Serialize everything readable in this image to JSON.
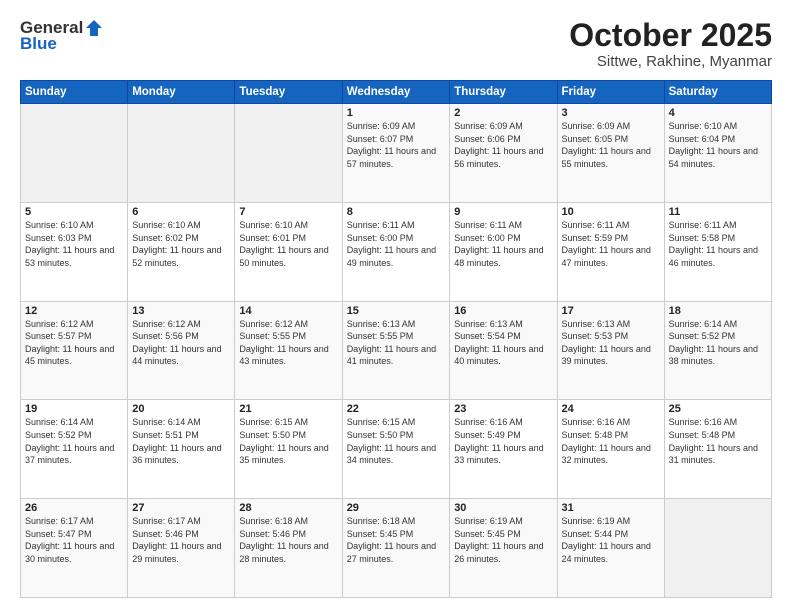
{
  "logo": {
    "general": "General",
    "blue": "Blue"
  },
  "header": {
    "month": "October 2025",
    "location": "Sittwe, Rakhine, Myanmar"
  },
  "weekdays": [
    "Sunday",
    "Monday",
    "Tuesday",
    "Wednesday",
    "Thursday",
    "Friday",
    "Saturday"
  ],
  "weeks": [
    [
      {
        "day": "",
        "sunrise": "",
        "sunset": "",
        "daylight": ""
      },
      {
        "day": "",
        "sunrise": "",
        "sunset": "",
        "daylight": ""
      },
      {
        "day": "",
        "sunrise": "",
        "sunset": "",
        "daylight": ""
      },
      {
        "day": "1",
        "sunrise": "Sunrise: 6:09 AM",
        "sunset": "Sunset: 6:07 PM",
        "daylight": "Daylight: 11 hours and 57 minutes."
      },
      {
        "day": "2",
        "sunrise": "Sunrise: 6:09 AM",
        "sunset": "Sunset: 6:06 PM",
        "daylight": "Daylight: 11 hours and 56 minutes."
      },
      {
        "day": "3",
        "sunrise": "Sunrise: 6:09 AM",
        "sunset": "Sunset: 6:05 PM",
        "daylight": "Daylight: 11 hours and 55 minutes."
      },
      {
        "day": "4",
        "sunrise": "Sunrise: 6:10 AM",
        "sunset": "Sunset: 6:04 PM",
        "daylight": "Daylight: 11 hours and 54 minutes."
      }
    ],
    [
      {
        "day": "5",
        "sunrise": "Sunrise: 6:10 AM",
        "sunset": "Sunset: 6:03 PM",
        "daylight": "Daylight: 11 hours and 53 minutes."
      },
      {
        "day": "6",
        "sunrise": "Sunrise: 6:10 AM",
        "sunset": "Sunset: 6:02 PM",
        "daylight": "Daylight: 11 hours and 52 minutes."
      },
      {
        "day": "7",
        "sunrise": "Sunrise: 6:10 AM",
        "sunset": "Sunset: 6:01 PM",
        "daylight": "Daylight: 11 hours and 50 minutes."
      },
      {
        "day": "8",
        "sunrise": "Sunrise: 6:11 AM",
        "sunset": "Sunset: 6:00 PM",
        "daylight": "Daylight: 11 hours and 49 minutes."
      },
      {
        "day": "9",
        "sunrise": "Sunrise: 6:11 AM",
        "sunset": "Sunset: 6:00 PM",
        "daylight": "Daylight: 11 hours and 48 minutes."
      },
      {
        "day": "10",
        "sunrise": "Sunrise: 6:11 AM",
        "sunset": "Sunset: 5:59 PM",
        "daylight": "Daylight: 11 hours and 47 minutes."
      },
      {
        "day": "11",
        "sunrise": "Sunrise: 6:11 AM",
        "sunset": "Sunset: 5:58 PM",
        "daylight": "Daylight: 11 hours and 46 minutes."
      }
    ],
    [
      {
        "day": "12",
        "sunrise": "Sunrise: 6:12 AM",
        "sunset": "Sunset: 5:57 PM",
        "daylight": "Daylight: 11 hours and 45 minutes."
      },
      {
        "day": "13",
        "sunrise": "Sunrise: 6:12 AM",
        "sunset": "Sunset: 5:56 PM",
        "daylight": "Daylight: 11 hours and 44 minutes."
      },
      {
        "day": "14",
        "sunrise": "Sunrise: 6:12 AM",
        "sunset": "Sunset: 5:55 PM",
        "daylight": "Daylight: 11 hours and 43 minutes."
      },
      {
        "day": "15",
        "sunrise": "Sunrise: 6:13 AM",
        "sunset": "Sunset: 5:55 PM",
        "daylight": "Daylight: 11 hours and 41 minutes."
      },
      {
        "day": "16",
        "sunrise": "Sunrise: 6:13 AM",
        "sunset": "Sunset: 5:54 PM",
        "daylight": "Daylight: 11 hours and 40 minutes."
      },
      {
        "day": "17",
        "sunrise": "Sunrise: 6:13 AM",
        "sunset": "Sunset: 5:53 PM",
        "daylight": "Daylight: 11 hours and 39 minutes."
      },
      {
        "day": "18",
        "sunrise": "Sunrise: 6:14 AM",
        "sunset": "Sunset: 5:52 PM",
        "daylight": "Daylight: 11 hours and 38 minutes."
      }
    ],
    [
      {
        "day": "19",
        "sunrise": "Sunrise: 6:14 AM",
        "sunset": "Sunset: 5:52 PM",
        "daylight": "Daylight: 11 hours and 37 minutes."
      },
      {
        "day": "20",
        "sunrise": "Sunrise: 6:14 AM",
        "sunset": "Sunset: 5:51 PM",
        "daylight": "Daylight: 11 hours and 36 minutes."
      },
      {
        "day": "21",
        "sunrise": "Sunrise: 6:15 AM",
        "sunset": "Sunset: 5:50 PM",
        "daylight": "Daylight: 11 hours and 35 minutes."
      },
      {
        "day": "22",
        "sunrise": "Sunrise: 6:15 AM",
        "sunset": "Sunset: 5:50 PM",
        "daylight": "Daylight: 11 hours and 34 minutes."
      },
      {
        "day": "23",
        "sunrise": "Sunrise: 6:16 AM",
        "sunset": "Sunset: 5:49 PM",
        "daylight": "Daylight: 11 hours and 33 minutes."
      },
      {
        "day": "24",
        "sunrise": "Sunrise: 6:16 AM",
        "sunset": "Sunset: 5:48 PM",
        "daylight": "Daylight: 11 hours and 32 minutes."
      },
      {
        "day": "25",
        "sunrise": "Sunrise: 6:16 AM",
        "sunset": "Sunset: 5:48 PM",
        "daylight": "Daylight: 11 hours and 31 minutes."
      }
    ],
    [
      {
        "day": "26",
        "sunrise": "Sunrise: 6:17 AM",
        "sunset": "Sunset: 5:47 PM",
        "daylight": "Daylight: 11 hours and 30 minutes."
      },
      {
        "day": "27",
        "sunrise": "Sunrise: 6:17 AM",
        "sunset": "Sunset: 5:46 PM",
        "daylight": "Daylight: 11 hours and 29 minutes."
      },
      {
        "day": "28",
        "sunrise": "Sunrise: 6:18 AM",
        "sunset": "Sunset: 5:46 PM",
        "daylight": "Daylight: 11 hours and 28 minutes."
      },
      {
        "day": "29",
        "sunrise": "Sunrise: 6:18 AM",
        "sunset": "Sunset: 5:45 PM",
        "daylight": "Daylight: 11 hours and 27 minutes."
      },
      {
        "day": "30",
        "sunrise": "Sunrise: 6:19 AM",
        "sunset": "Sunset: 5:45 PM",
        "daylight": "Daylight: 11 hours and 26 minutes."
      },
      {
        "day": "31",
        "sunrise": "Sunrise: 6:19 AM",
        "sunset": "Sunset: 5:44 PM",
        "daylight": "Daylight: 11 hours and 24 minutes."
      },
      {
        "day": "",
        "sunrise": "",
        "sunset": "",
        "daylight": ""
      }
    ]
  ]
}
